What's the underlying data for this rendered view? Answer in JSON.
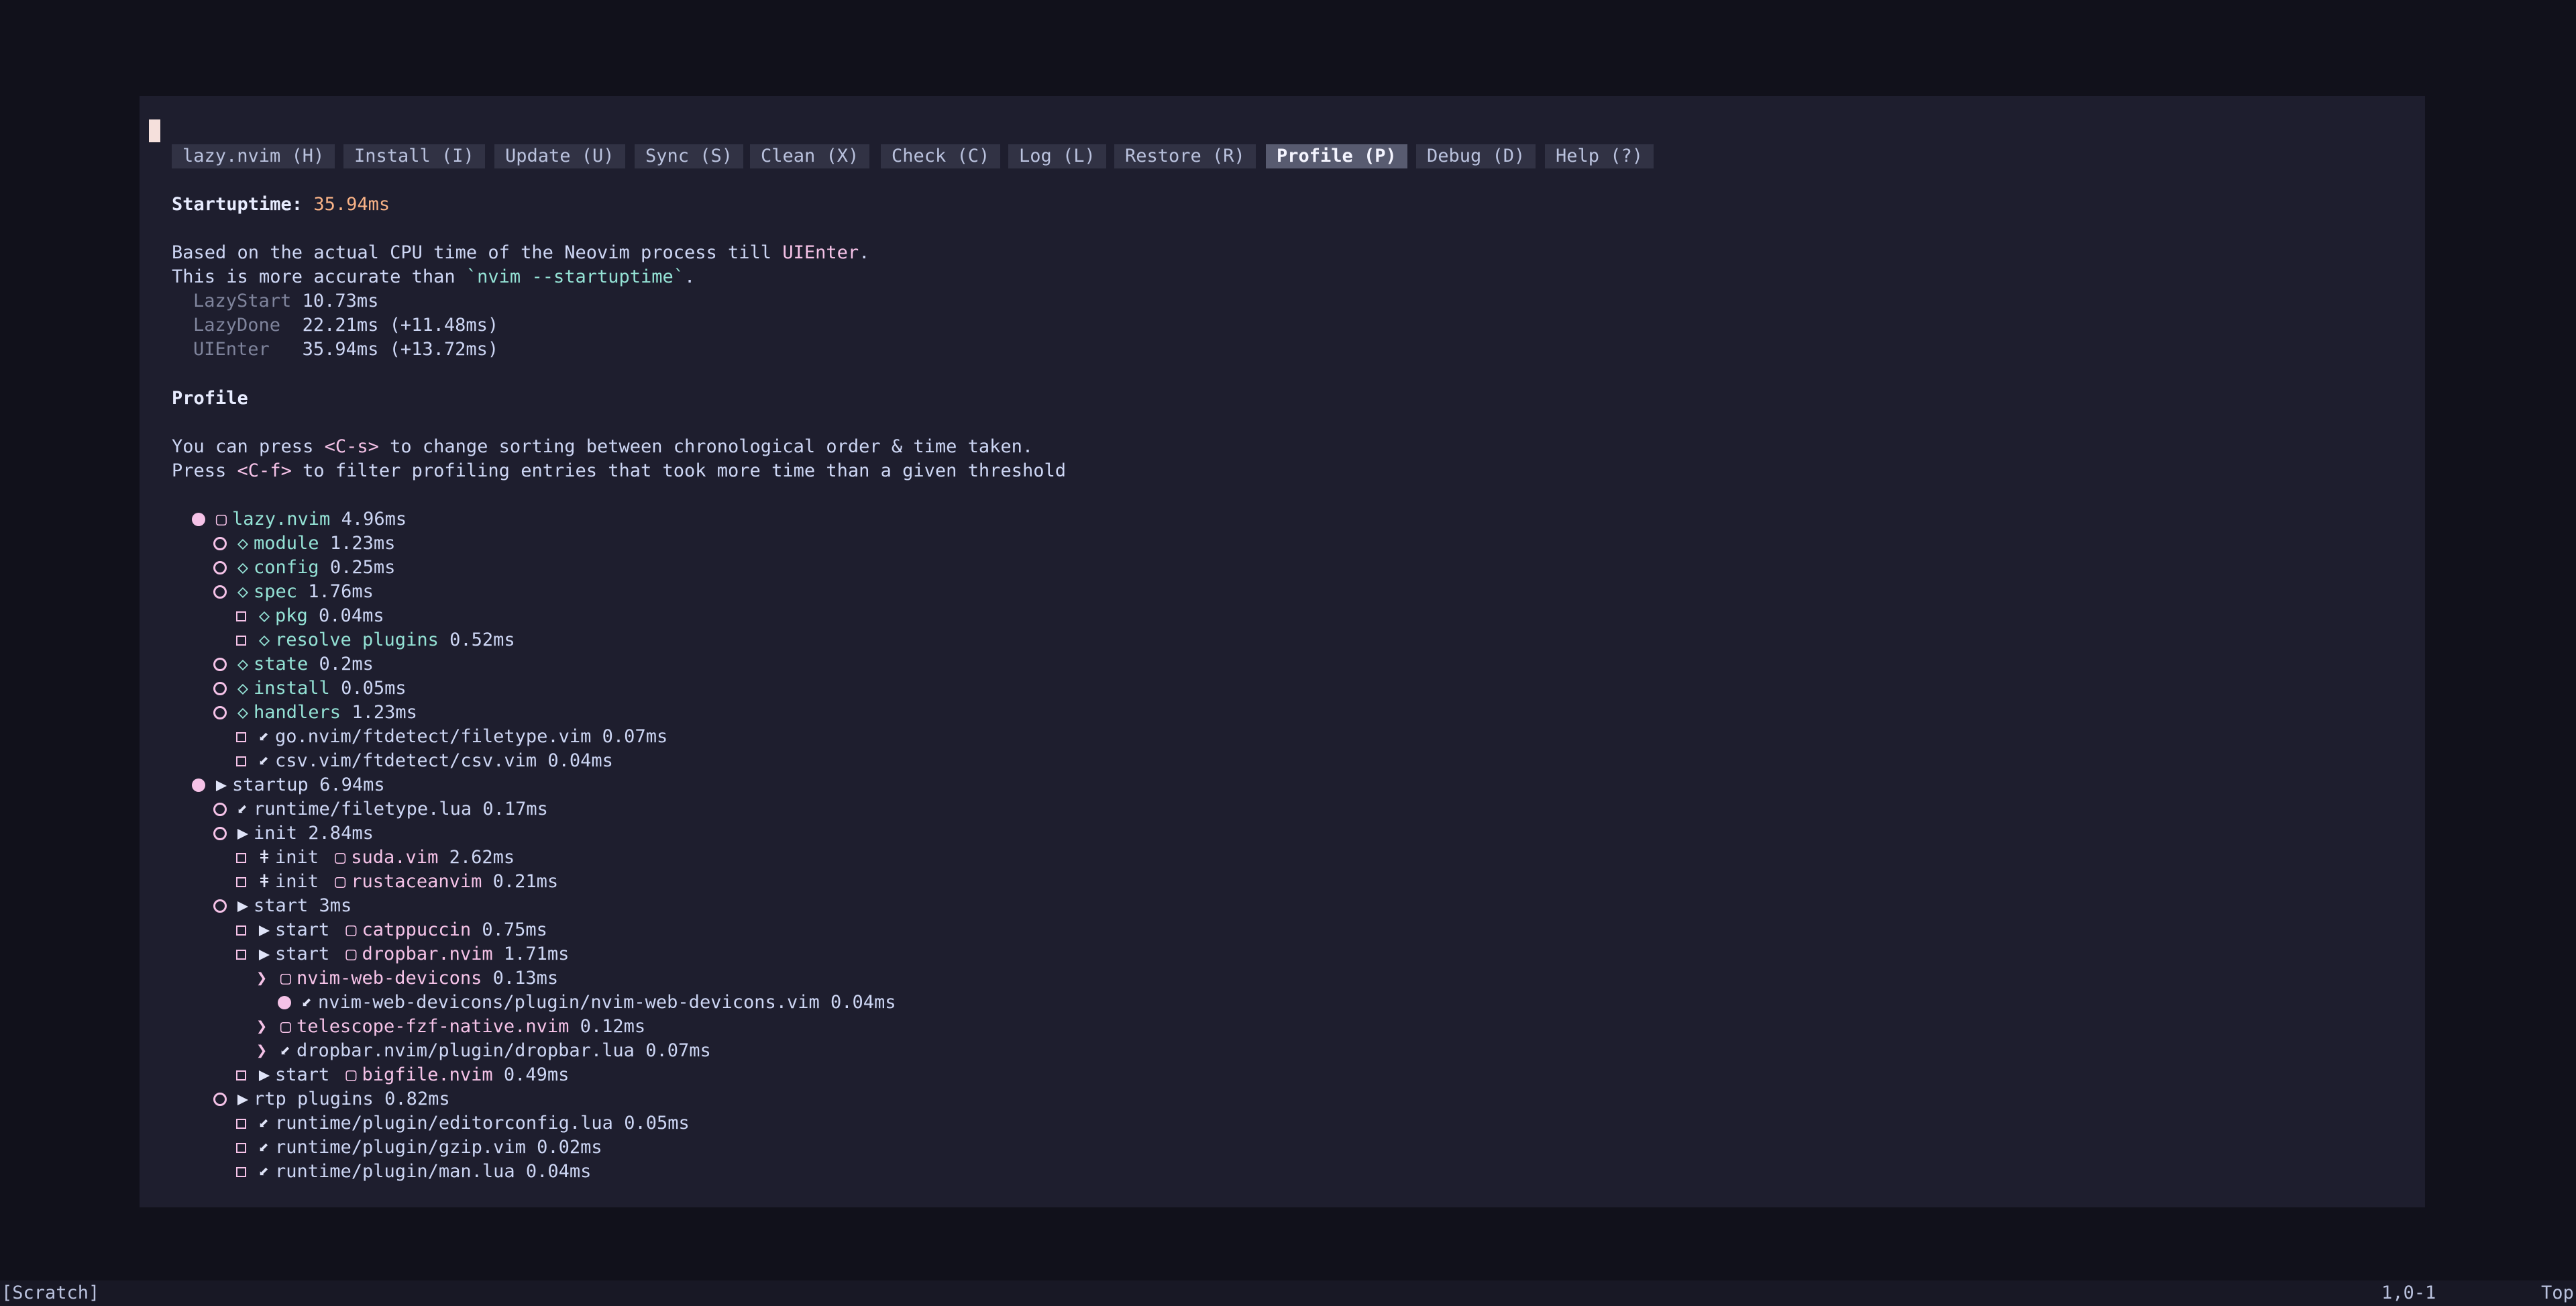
{
  "tabs": [
    {
      "label": "lazy.nvim (H)",
      "active": false
    },
    {
      "label": "Install (I)",
      "active": false
    },
    {
      "label": "Update (U)",
      "active": false
    },
    {
      "label": "Sync (S)",
      "active": false
    },
    {
      "label": "Clean (X)",
      "active": false
    },
    {
      "label": "Check (C)",
      "active": false
    },
    {
      "label": "Log (L)",
      "active": false
    },
    {
      "label": "Restore (R)",
      "active": false
    },
    {
      "label": "Profile (P)",
      "active": true
    },
    {
      "label": "Debug (D)",
      "active": false
    },
    {
      "label": "Help (?)",
      "active": false
    }
  ],
  "startup": {
    "label": "Startuptime: ",
    "value": "35.94ms",
    "desc1_prefix": "Based on the actual CPU time of the Neovim process till ",
    "desc1_highlight": "UIEnter",
    "desc1_suffix": ".",
    "desc2_prefix": "This is more accurate than ",
    "desc2_highlight": "`nvim --startuptime`",
    "desc2_suffix": ".",
    "stats": [
      {
        "name": "LazyStart",
        "value": "10.73ms"
      },
      {
        "name": "LazyDone ",
        "value": "22.21ms (+11.48ms)"
      },
      {
        "name": "UIEnter  ",
        "value": "35.94ms (+13.72ms)"
      }
    ]
  },
  "profile": {
    "heading": "Profile",
    "help1_prefix": "You can press ",
    "help1_key": "<C-s>",
    "help1_suffix": " to change sorting between chronological order & time taken.",
    "help2_prefix": "Press ",
    "help2_key": "<C-f>",
    "help2_suffix": " to filter profiling entries that took more time than a given threshold"
  },
  "tree": [
    {
      "level": 0,
      "bullet": "filled",
      "icon": "package-icon",
      "glyph": "▢",
      "icolor": "pink",
      "prefix": "",
      "name": "lazy.nvim",
      "ncolor": "green",
      "time": "4.96ms"
    },
    {
      "level": 1,
      "bullet": "hollow",
      "icon": "module-icon",
      "glyph": "◇",
      "icolor": "green",
      "prefix": "",
      "name": "module",
      "ncolor": "green",
      "time": "1.23ms"
    },
    {
      "level": 1,
      "bullet": "hollow",
      "icon": "module-icon",
      "glyph": "◇",
      "icolor": "green",
      "prefix": "",
      "name": "config",
      "ncolor": "green",
      "time": "0.25ms"
    },
    {
      "level": 1,
      "bullet": "hollow",
      "icon": "module-icon",
      "glyph": "◇",
      "icolor": "green",
      "prefix": "",
      "name": "spec",
      "ncolor": "green",
      "time": "1.76ms"
    },
    {
      "level": 2,
      "bullet": "square",
      "icon": "module-icon",
      "glyph": "◇",
      "icolor": "green",
      "prefix": "",
      "name": "pkg",
      "ncolor": "green",
      "time": "0.04ms"
    },
    {
      "level": 2,
      "bullet": "square",
      "icon": "module-icon",
      "glyph": "◇",
      "icolor": "green",
      "prefix": "",
      "name": "resolve plugins",
      "ncolor": "green",
      "time": "0.52ms"
    },
    {
      "level": 1,
      "bullet": "hollow",
      "icon": "module-icon",
      "glyph": "◇",
      "icolor": "green",
      "prefix": "",
      "name": "state",
      "ncolor": "green",
      "time": "0.2ms"
    },
    {
      "level": 1,
      "bullet": "hollow",
      "icon": "module-icon",
      "glyph": "◇",
      "icolor": "green",
      "prefix": "",
      "name": "install",
      "ncolor": "green",
      "time": "0.05ms"
    },
    {
      "level": 1,
      "bullet": "hollow",
      "icon": "module-icon",
      "glyph": "◇",
      "icolor": "green",
      "prefix": "",
      "name": "handlers",
      "ncolor": "green",
      "time": "1.23ms"
    },
    {
      "level": 2,
      "bullet": "square",
      "icon": "source-icon",
      "glyph": "⬋",
      "icolor": "white",
      "prefix": "",
      "name": "go.nvim/ftdetect/filetype.vim",
      "ncolor": "plain",
      "time": "0.07ms"
    },
    {
      "level": 2,
      "bullet": "square",
      "icon": "source-icon",
      "glyph": "⬋",
      "icolor": "white",
      "prefix": "",
      "name": "csv.vim/ftdetect/csv.vim",
      "ncolor": "plain",
      "time": "0.04ms"
    },
    {
      "level": 0,
      "bullet": "filled",
      "icon": "event-icon",
      "glyph": "▶",
      "icolor": "white",
      "prefix": "",
      "name": "startup",
      "ncolor": "plain",
      "time": "6.94ms"
    },
    {
      "level": 1,
      "bullet": "hollow",
      "icon": "source-icon",
      "glyph": "⬋",
      "icolor": "white",
      "prefix": "",
      "name": "runtime/filetype.lua",
      "ncolor": "plain",
      "time": "0.17ms"
    },
    {
      "level": 1,
      "bullet": "hollow",
      "icon": "event-icon",
      "glyph": "▶",
      "icolor": "white",
      "prefix": "",
      "name": "init",
      "ncolor": "plain",
      "time": "2.84ms"
    },
    {
      "level": 2,
      "bullet": "square",
      "icon": "init-icon",
      "glyph": "ǂ",
      "icolor": "white",
      "prefix": "init ",
      "pglyph": "▢",
      "name": "suda.vim",
      "ncolor": "pink",
      "time": "2.62ms"
    },
    {
      "level": 2,
      "bullet": "square",
      "icon": "init-icon",
      "glyph": "ǂ",
      "icolor": "white",
      "prefix": "init ",
      "pglyph": "▢",
      "name": "rustaceanvim",
      "ncolor": "pink",
      "time": "0.21ms"
    },
    {
      "level": 1,
      "bullet": "hollow",
      "icon": "event-icon",
      "glyph": "▶",
      "icolor": "white",
      "prefix": "",
      "name": "start",
      "ncolor": "plain",
      "time": "3ms"
    },
    {
      "level": 2,
      "bullet": "square",
      "icon": "event-icon",
      "glyph": "▶",
      "icolor": "white",
      "prefix": "start ",
      "pglyph": "▢",
      "name": "catppuccin",
      "ncolor": "pink",
      "time": "0.75ms"
    },
    {
      "level": 2,
      "bullet": "square",
      "icon": "event-icon",
      "glyph": "▶",
      "icolor": "white",
      "prefix": "start ",
      "pglyph": "▢",
      "name": "dropbar.nvim",
      "ncolor": "pink",
      "time": "1.71ms"
    },
    {
      "level": 3,
      "bullet": "chev",
      "icon": "package-icon",
      "glyph": "▢",
      "icolor": "pink",
      "prefix": "",
      "name": "nvim-web-devicons",
      "ncolor": "pink",
      "time": "0.13ms"
    },
    {
      "level": 4,
      "bullet": "filled",
      "icon": "source-icon",
      "glyph": "⬋",
      "icolor": "white",
      "prefix": "",
      "name": "nvim-web-devicons/plugin/nvim-web-devicons.vim",
      "ncolor": "plain",
      "time": "0.04ms"
    },
    {
      "level": 3,
      "bullet": "chev",
      "icon": "package-icon",
      "glyph": "▢",
      "icolor": "pink",
      "prefix": "",
      "name": "telescope-fzf-native.nvim",
      "ncolor": "pink",
      "time": "0.12ms"
    },
    {
      "level": 3,
      "bullet": "chev",
      "icon": "source-icon",
      "glyph": "⬋",
      "icolor": "white",
      "prefix": "",
      "name": "dropbar.nvim/plugin/dropbar.lua",
      "ncolor": "plain",
      "time": "0.07ms"
    },
    {
      "level": 2,
      "bullet": "square",
      "icon": "event-icon",
      "glyph": "▶",
      "icolor": "white",
      "prefix": "start ",
      "pglyph": "▢",
      "name": "bigfile.nvim",
      "ncolor": "pink",
      "time": "0.49ms"
    },
    {
      "level": 1,
      "bullet": "hollow",
      "icon": "event-icon",
      "glyph": "▶",
      "icolor": "white",
      "prefix": "",
      "name": "rtp plugins",
      "ncolor": "plain",
      "time": "0.82ms"
    },
    {
      "level": 2,
      "bullet": "square",
      "icon": "source-icon",
      "glyph": "⬋",
      "icolor": "white",
      "prefix": "",
      "name": "runtime/plugin/editorconfig.lua",
      "ncolor": "plain",
      "time": "0.05ms"
    },
    {
      "level": 2,
      "bullet": "square",
      "icon": "source-icon",
      "glyph": "⬋",
      "icolor": "white",
      "prefix": "",
      "name": "runtime/plugin/gzip.vim",
      "ncolor": "plain",
      "time": "0.02ms"
    },
    {
      "level": 2,
      "bullet": "square",
      "icon": "source-icon",
      "glyph": "⬋",
      "icolor": "white",
      "prefix": "",
      "name": "runtime/plugin/man.lua",
      "ncolor": "plain",
      "time": "0.04ms"
    }
  ],
  "statusline": {
    "buffer": "[Scratch]",
    "position": "1,0-1",
    "scroll": "Top"
  }
}
